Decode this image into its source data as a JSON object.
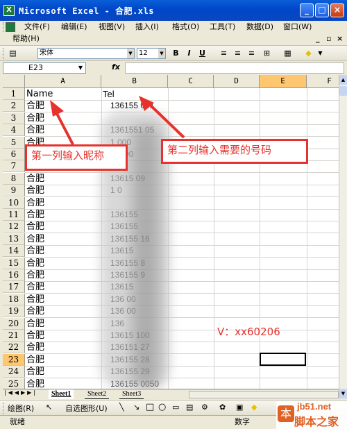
{
  "window": {
    "title": "Microsoft Excel - 合肥.xls",
    "icon": "excel-icon"
  },
  "menu": {
    "items": [
      "文件(F)",
      "编辑(E)",
      "视图(V)",
      "插入(I)",
      "格式(O)",
      "工具(T)",
      "数据(D)",
      "窗口(W)"
    ],
    "help": "帮助(H)"
  },
  "toolbar": {
    "font": "宋体",
    "size": "12",
    "bold": "B",
    "italic": "I",
    "underline": "U"
  },
  "formula": {
    "cell_ref": "E23",
    "fx": "fx",
    "content": ""
  },
  "columns": [
    "A",
    "B",
    "C",
    "D",
    "E",
    "F"
  ],
  "rows": [
    {
      "n": "1",
      "a": "Name",
      "b": "Tel"
    },
    {
      "n": "2",
      "a": "合肥",
      "b": "136155  001"
    },
    {
      "n": "3",
      "a": "合肥",
      "b": ""
    },
    {
      "n": "4",
      "a": "合肥",
      "b": "1361551    05"
    },
    {
      "n": "5",
      "a": "合肥",
      "b": "1       000"
    },
    {
      "n": "6",
      "a": "合肥",
      "b": "       51000"
    },
    {
      "n": "7",
      "a": "合肥",
      "b": ""
    },
    {
      "n": "8",
      "a": "合肥",
      "b": "13615     09"
    },
    {
      "n": "9",
      "a": "合肥",
      "b": "1       0"
    },
    {
      "n": "10",
      "a": "合肥",
      "b": ""
    },
    {
      "n": "11",
      "a": "合肥",
      "b": "136155"
    },
    {
      "n": "12",
      "a": "合肥",
      "b": "136155"
    },
    {
      "n": "13",
      "a": "合肥",
      "b": "136155     16"
    },
    {
      "n": "14",
      "a": "合肥",
      "b": "13615"
    },
    {
      "n": "15",
      "a": "合肥",
      "b": "136155      8"
    },
    {
      "n": "16",
      "a": "合肥",
      "b": "136155      9"
    },
    {
      "n": "17",
      "a": "合肥",
      "b": "13615"
    },
    {
      "n": "18",
      "a": "合肥",
      "b": "136    00"
    },
    {
      "n": "19",
      "a": "合肥",
      "b": "136    00"
    },
    {
      "n": "20",
      "a": "合肥",
      "b": "136"
    },
    {
      "n": "21",
      "a": "合肥",
      "b": "13615   100"
    },
    {
      "n": "22",
      "a": "合肥",
      "b": "136151     27"
    },
    {
      "n": "23",
      "a": "合肥",
      "b": "136155     28"
    },
    {
      "n": "24",
      "a": "合肥",
      "b": "136155     29"
    },
    {
      "n": "25",
      "a": "合肥",
      "b": "136155  0050"
    }
  ],
  "annotations": {
    "note1": "第一列输入昵称",
    "note2": "第二列输入需要的号码",
    "vtext": "V：xx60206"
  },
  "sheets": [
    "Sheet1",
    "Sheet2",
    "Sheet3"
  ],
  "drawbar": {
    "draw": "绘图(R)",
    "autoshape": "自选图形(U)"
  },
  "status": {
    "ready": "就绪",
    "num": "数字"
  },
  "watermark": {
    "site": "jb51.net",
    "name": "脚本之家",
    "logo": "本"
  },
  "colors": {
    "accent": "#e8312c",
    "title": "#0a5fd8"
  }
}
